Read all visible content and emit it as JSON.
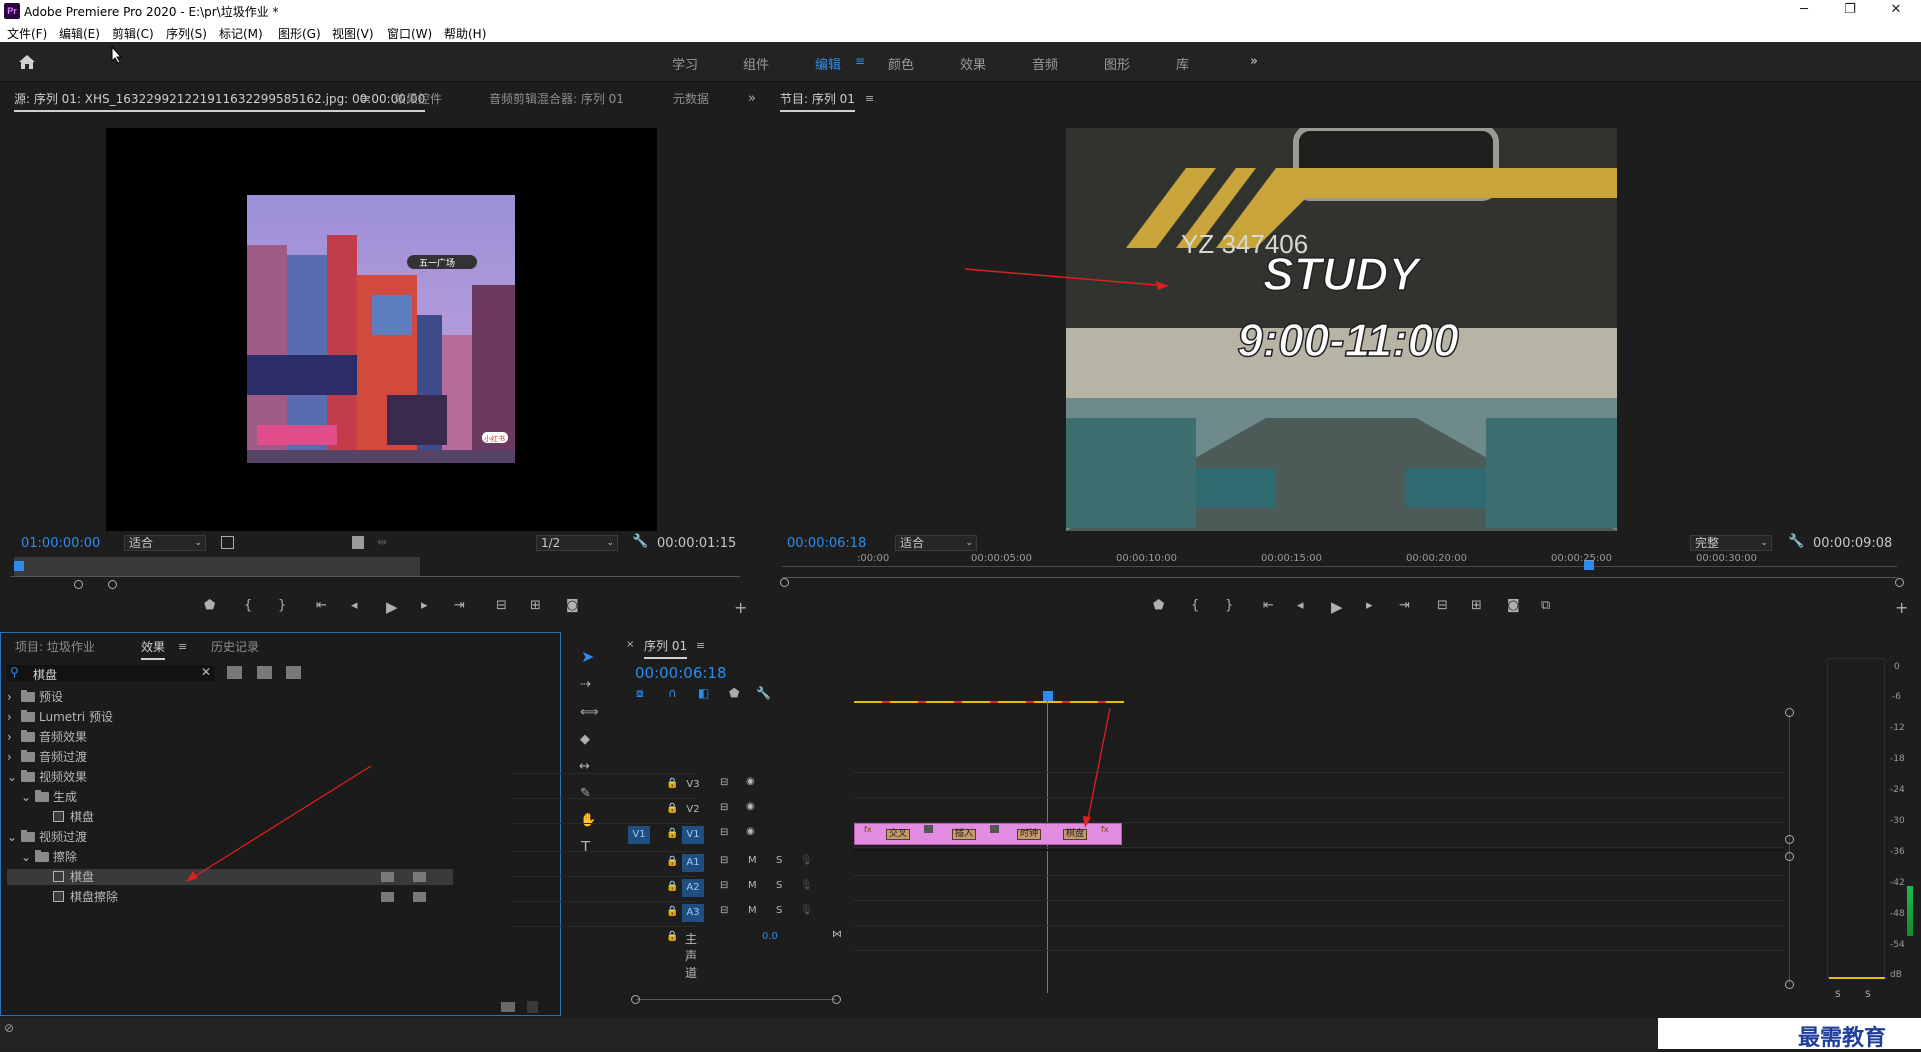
{
  "window": {
    "app_icon_text": "Pr",
    "title": "Adobe Premiere Pro 2020 - E:\\pr\\垃圾作业 *",
    "minimize": "─",
    "maximize": "❐",
    "close": "✕"
  },
  "menu": [
    "文件(F)",
    "编辑(E)",
    "剪辑(C)",
    "序列(S)",
    "标记(M)",
    "图形(G)",
    "视图(V)",
    "窗口(W)",
    "帮助(H)"
  ],
  "workspaces": {
    "items": [
      "学习",
      "组件",
      "编辑",
      "颜色",
      "效果",
      "音频",
      "图形",
      "库"
    ],
    "active": "编辑",
    "more": "»"
  },
  "source_panel": {
    "tabs": [
      "源: 序列 01: XHS_16322992122191163229958516​2.jpg: 00:00:00:00",
      "效果控件",
      "音频剪辑混合器: 序列 01",
      "元数据"
    ],
    "timecode": "01:00:00:00",
    "fit": "适合",
    "resolution": "1/2",
    "duration": "00:00:01:15",
    "thumb_text_1": "五一广场",
    "thumb_text_2": "小红书"
  },
  "program_panel": {
    "tab": "节目: 序列 01",
    "timecode": "00:00:06:18",
    "fit": "适合",
    "quality": "完整",
    "duration": "00:00:09:08",
    "video_text_1": "STUDY",
    "video_text_2": "9:00-11:00",
    "plate_text": "YZ 347406"
  },
  "project_panel": {
    "tabs": [
      "项目: 垃圾作业",
      "效果",
      "历史记录"
    ],
    "active_tab": "效果",
    "search_value": "棋盘",
    "tree": [
      {
        "label": "预设",
        "level": 0,
        "type": "folder",
        "open": false
      },
      {
        "label": "Lumetri 预设",
        "level": 0,
        "type": "folder",
        "open": false
      },
      {
        "label": "音频效果",
        "level": 0,
        "type": "folder",
        "open": false
      },
      {
        "label": "音频过渡",
        "level": 0,
        "type": "folder",
        "open": false
      },
      {
        "label": "视频效果",
        "level": 0,
        "type": "folder",
        "open": true
      },
      {
        "label": "生成",
        "level": 1,
        "type": "folder",
        "open": true
      },
      {
        "label": "棋盘",
        "level": 2,
        "type": "effect"
      },
      {
        "label": "视频过渡",
        "level": 0,
        "type": "folder",
        "open": true
      },
      {
        "label": "擦除",
        "level": 1,
        "type": "folder",
        "open": true
      },
      {
        "label": "棋盘",
        "level": 2,
        "type": "effect",
        "selected": true
      },
      {
        "label": "棋盘擦除",
        "level": 2,
        "type": "effect"
      }
    ]
  },
  "timeline": {
    "tab": "序列 01",
    "timecode": "00:00:06:18",
    "ruler": [
      ":00:00",
      "00:00:05:00",
      "00:00:10:00",
      "00:00:15:00",
      "00:00:20:00",
      "00:00:25:00",
      "00:00:30:00"
    ],
    "tracks": [
      {
        "name": "V3",
        "type": "video"
      },
      {
        "name": "V2",
        "type": "video"
      },
      {
        "name": "V1",
        "type": "video",
        "source": "V1"
      },
      {
        "name": "A1",
        "type": "audio"
      },
      {
        "name": "A2",
        "type": "audio"
      },
      {
        "name": "A3",
        "type": "audio"
      }
    ],
    "master_label": "主声道",
    "master_value": "0.0",
    "mute": "M",
    "solo": "S",
    "clips": [
      "交叉",
      "插入",
      "时钟",
      "棋盘"
    ]
  },
  "audio_meter": {
    "ticks": [
      "0",
      "-6",
      "-12",
      "-18",
      "-24",
      "-30",
      "-36",
      "-42",
      "-48",
      "-54",
      "dB"
    ],
    "solo_labels": [
      "S",
      "S"
    ]
  },
  "watermark": "最需教育"
}
